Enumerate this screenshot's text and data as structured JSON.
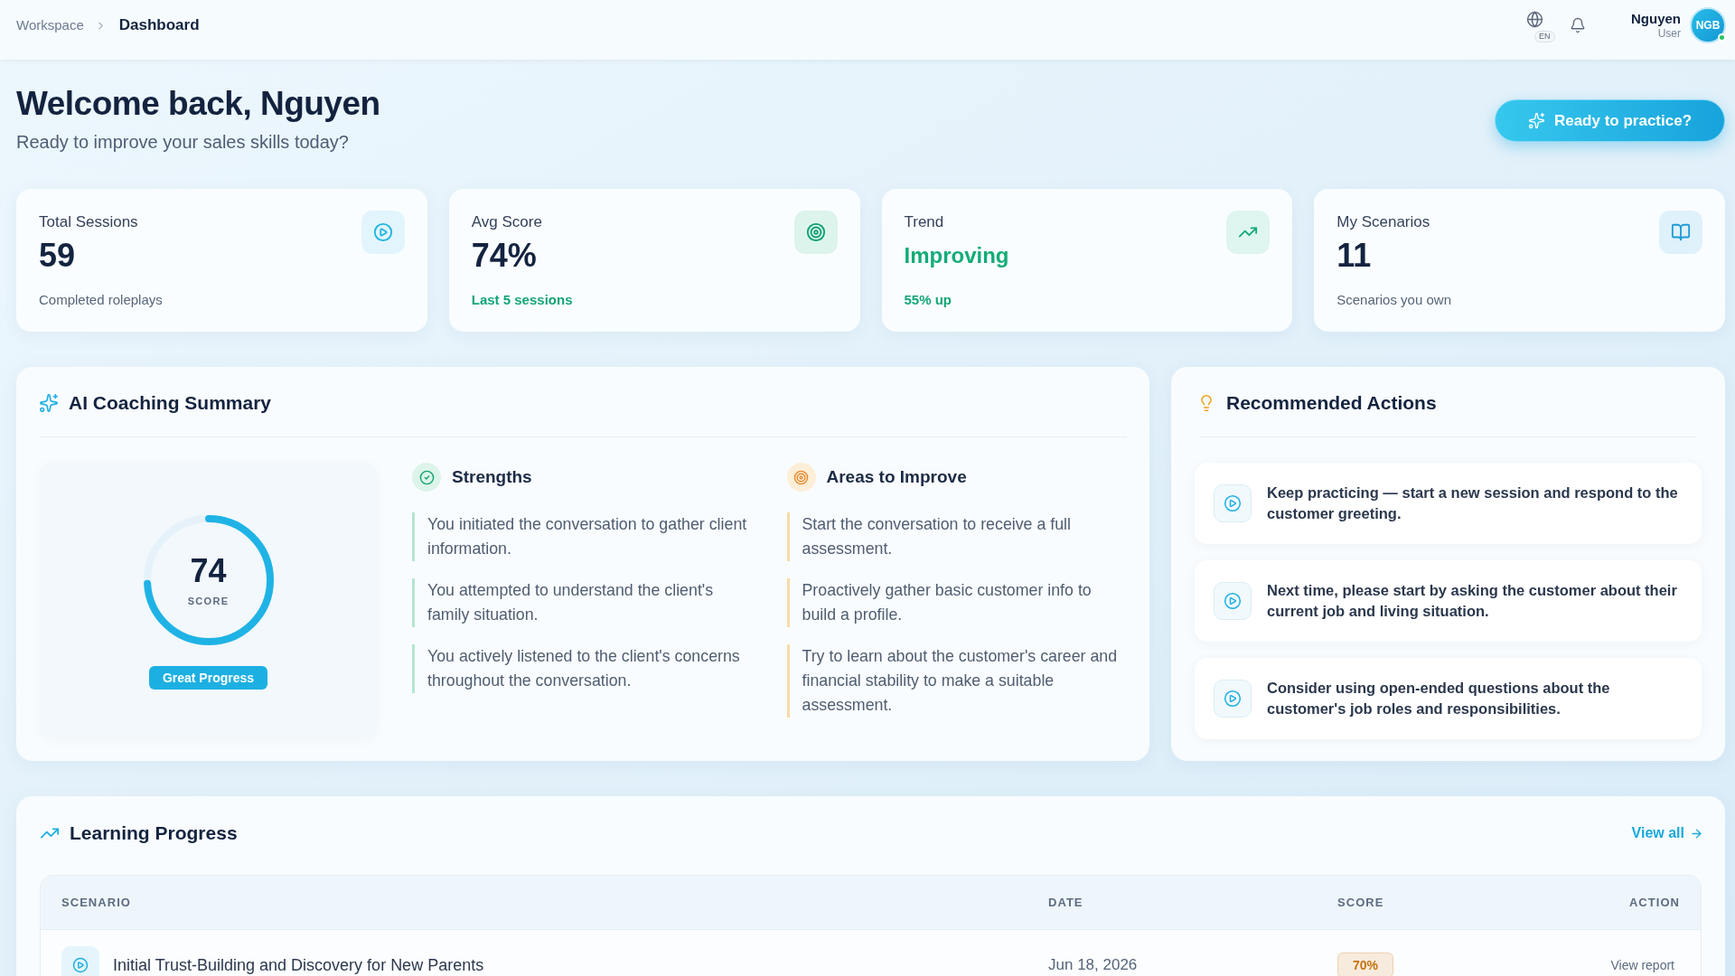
{
  "topbar": {
    "breadcrumb": [
      "Workspace",
      "Dashboard"
    ],
    "language": "EN",
    "user": {
      "name": "Nguyen",
      "role": "User",
      "initials": "NGB",
      "online": true
    }
  },
  "header": {
    "title": "Welcome back, Nguyen",
    "subtitle": "Ready to improve your sales skills today?",
    "cta": "Ready to practice?"
  },
  "stats": [
    {
      "kind": "sessions",
      "label": "Total Sessions",
      "value": "59",
      "note": "Completed roleplays",
      "highlight": false,
      "positive": false
    },
    {
      "kind": "score",
      "label": "Avg Score",
      "value": "74%",
      "note": "Last 5 sessions",
      "highlight": false,
      "positive": true
    },
    {
      "kind": "trend",
      "label": "Trend",
      "value": "Improving",
      "note": "55% up",
      "highlight": true,
      "positive": true
    },
    {
      "kind": "scenarios",
      "label": "My Scenarios",
      "value": "11",
      "note": "Scenarios you own",
      "highlight": false,
      "positive": false
    }
  ],
  "coaching": {
    "title": "AI Coaching Summary",
    "score": {
      "value": "74",
      "label": "SCORE",
      "level": 0.74,
      "badge": "Great Progress"
    },
    "columns": [
      {
        "kind": "strengths",
        "title": "Strengths",
        "items": [
          "You initiated the conversation to gather client information.",
          "You attempted to understand the client's family situation.",
          "You actively listened to the client's concerns throughout the conversation."
        ]
      },
      {
        "kind": "improve",
        "title": "Areas to Improve",
        "items": [
          "Start the conversation to receive a full assessment.",
          "Proactively gather basic customer info to build a profile.",
          "Try to learn about the customer's career and financial stability to make a suitable assessment."
        ]
      }
    ]
  },
  "recommended": {
    "title": "Recommended Actions",
    "items": [
      "Keep practicing — start a new session and respond to the customer greeting.",
      "Next time, please start by asking the customer about their current job and living situation.",
      "Consider using open-ended questions about the customer's job roles and responsibilities."
    ]
  },
  "progress": {
    "title": "Learning Progress",
    "link": "View all",
    "columns": [
      "SCENARIO",
      "DATE",
      "SCORE",
      "ACTION"
    ],
    "rows": [
      {
        "scenario": "Initial Trust-Building and Discovery for New Parents",
        "date": "Jun 18, 2026",
        "score": "70%",
        "color": "#c7730f",
        "action": "View report"
      }
    ]
  }
}
